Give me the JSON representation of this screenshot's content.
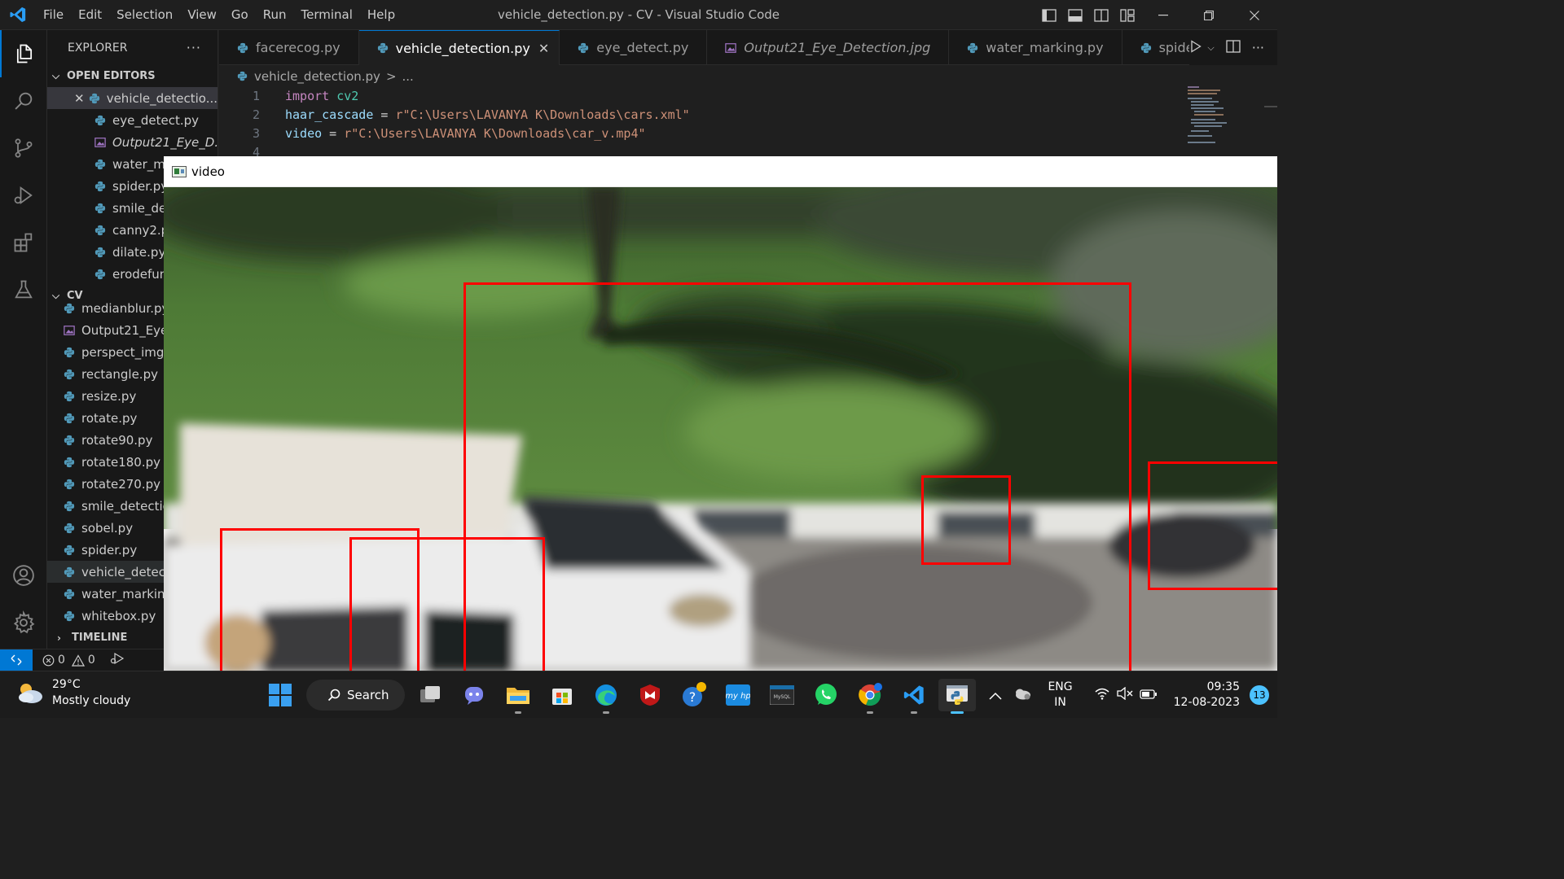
{
  "window": {
    "title": "vehicle_detection.py - CV - Visual Studio Code",
    "menu": [
      "File",
      "Edit",
      "Selection",
      "View",
      "Go",
      "Run",
      "Terminal",
      "Help"
    ]
  },
  "sidebar": {
    "title": "EXPLORER",
    "more": "···",
    "open_editors_label": "OPEN EDITORS",
    "open_editors": [
      {
        "name": "vehicle_detectio...",
        "icon": "python-icon"
      },
      {
        "name": "eye_detect.py",
        "icon": "python-icon"
      },
      {
        "name": "Output21_Eye_D...",
        "icon": "image-icon"
      },
      {
        "name": "water_ma",
        "icon": "python-icon"
      },
      {
        "name": "spider.py",
        "icon": "python-icon"
      },
      {
        "name": "smile_det",
        "icon": "python-icon"
      },
      {
        "name": "canny2.p",
        "icon": "python-icon"
      },
      {
        "name": "dilate.py",
        "icon": "python-icon"
      },
      {
        "name": "erodefun",
        "icon": "python-icon"
      }
    ],
    "folder_label": "CV",
    "files": [
      {
        "name": "medianblur.py",
        "icon": "python-icon"
      },
      {
        "name": "Output21_Eye",
        "icon": "image-icon"
      },
      {
        "name": "perspect_img.",
        "icon": "python-icon"
      },
      {
        "name": "rectangle.py",
        "icon": "python-icon"
      },
      {
        "name": "resize.py",
        "icon": "python-icon"
      },
      {
        "name": "rotate.py",
        "icon": "python-icon"
      },
      {
        "name": "rotate90.py",
        "icon": "python-icon"
      },
      {
        "name": "rotate180.py",
        "icon": "python-icon"
      },
      {
        "name": "rotate270.py",
        "icon": "python-icon"
      },
      {
        "name": "smile_detectio",
        "icon": "python-icon"
      },
      {
        "name": "sobel.py",
        "icon": "python-icon"
      },
      {
        "name": "spider.py",
        "icon": "python-icon"
      },
      {
        "name": "vehicle_detect",
        "icon": "python-icon"
      },
      {
        "name": "water_marking",
        "icon": "python-icon"
      },
      {
        "name": "whitebox.py",
        "icon": "python-icon"
      }
    ],
    "timeline_label": "TIMELINE"
  },
  "tabs": [
    {
      "label": "facerecog.py",
      "icon": "python-icon",
      "active": false,
      "italic": false
    },
    {
      "label": "vehicle_detection.py",
      "icon": "python-icon",
      "active": true,
      "italic": false
    },
    {
      "label": "eye_detect.py",
      "icon": "python-icon",
      "active": false,
      "italic": false
    },
    {
      "label": "Output21_Eye_Detection.jpg",
      "icon": "image-icon",
      "active": false,
      "italic": true
    },
    {
      "label": "water_marking.py",
      "icon": "python-icon",
      "active": false,
      "italic": false
    },
    {
      "label": "spider.py",
      "icon": "python-icon",
      "active": false,
      "italic": false
    }
  ],
  "breadcrumb": {
    "file": "vehicle_detection.py",
    "sep": ">",
    "rest": "..."
  },
  "code": {
    "line_numbers": [
      "1",
      "2",
      "3",
      "4"
    ],
    "l1_kw": "import",
    "l1_mod": "cv2",
    "l2_var": "haar_cascade",
    "l2_op": " = ",
    "l2_str": "r\"C:\\Users\\LAVANYA K\\Downloads\\cars.xml\"",
    "l3_var": "video",
    "l3_op": " = ",
    "l3_str": "r\"C:\\Users\\LAVANYA K\\Downloads\\car_v.mp4\""
  },
  "video_window": {
    "title": "video"
  },
  "status": {
    "errors": "0",
    "warnings": "0"
  },
  "taskbar": {
    "temperature": "29°C",
    "weather": "Mostly cloudy",
    "search": "Search",
    "lang_top": "ENG",
    "lang_bottom": "IN",
    "time": "09:35",
    "date": "12-08-2023",
    "notifications": "13"
  },
  "colors": {
    "accent": "#0078d4",
    "detection_box": "#ff0000"
  }
}
